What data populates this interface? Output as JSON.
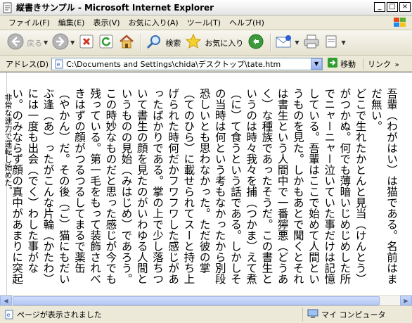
{
  "window": {
    "title": "縦書きサンプル - Microsoft Internet Explorer",
    "controls": {
      "minimize": "_",
      "maximize": "□",
      "close": "×"
    }
  },
  "menu": [
    "ファイル(F)",
    "編集(E)",
    "表示(V)",
    "お気に入り(A)",
    "ツール(T)",
    "ヘルプ(H)"
  ],
  "toolbar": {
    "back_label": "戻る",
    "search_label": "検索",
    "favorites_label": "お気に入り"
  },
  "address": {
    "label": "アドレス(D)",
    "value": "C:\\Documents and Settings\\chida\\デスクトップ\\tate.htm",
    "go_label": "移動",
    "links_label": "リンク",
    "links_chevron": "»"
  },
  "content": {
    "text": "吾輩（わがはい）は猫である。名前はまだ無い。\nどこで生れたかとんと見当（けんとう）がつかぬ。何でも薄暗いじめじめした所でニャーニャー泣いていた事だけは記憶している。吾輩はここで始めて人間というものを見た。しかもあとで聞くとそれは書生という人間中で一番獰悪（どうあく）な種族であったそうだ。この書生というのは時々我々を捕（つかま）えて煮（に）て食うという話である。しかしその当時は何という考もなかったから別段恐しいとも思わなかった。ただ彼の掌（てのひら）に載せられてスーと持ち上げられた時何だかフワフワした感じがあったばかりである。掌の上で少し落ちついて書生の顔を見たのがいわゆる人間というものの見始（みはじめ）であろう。この時妙なものだと思った感じが今でも残っている。第一毛をもって装飾されべきはずの顔がつるつるしてまるで薬缶（やかん）だ。その後（ご）猫にもだいぶ逢（あ）ったがこんな片輪（かたわ）には一度も出会（でく）わした事がない。のみならず顔の真中があまりに突起している。そうしてその穴の中から時々ぷうぷうと煙（けむり）を吹く。どうも咽（む）せぽくて実に弱った。これが人間の飲む煙草（たばこ）というものである事はようやくこの頃知った。\nこの書生の掌の裏（うら）でしばらくはよい心持に坐っておったが、しばらくすると",
    "left_edge": "非常な速力で運転し始めた。"
  },
  "status": {
    "text": "ページが表示されました",
    "zone": "マイ コンピュータ"
  },
  "colors": {
    "xp_blue": "#2a5fd6",
    "go_green": "#2f9e2f",
    "stop_red": "#d33b2b"
  }
}
